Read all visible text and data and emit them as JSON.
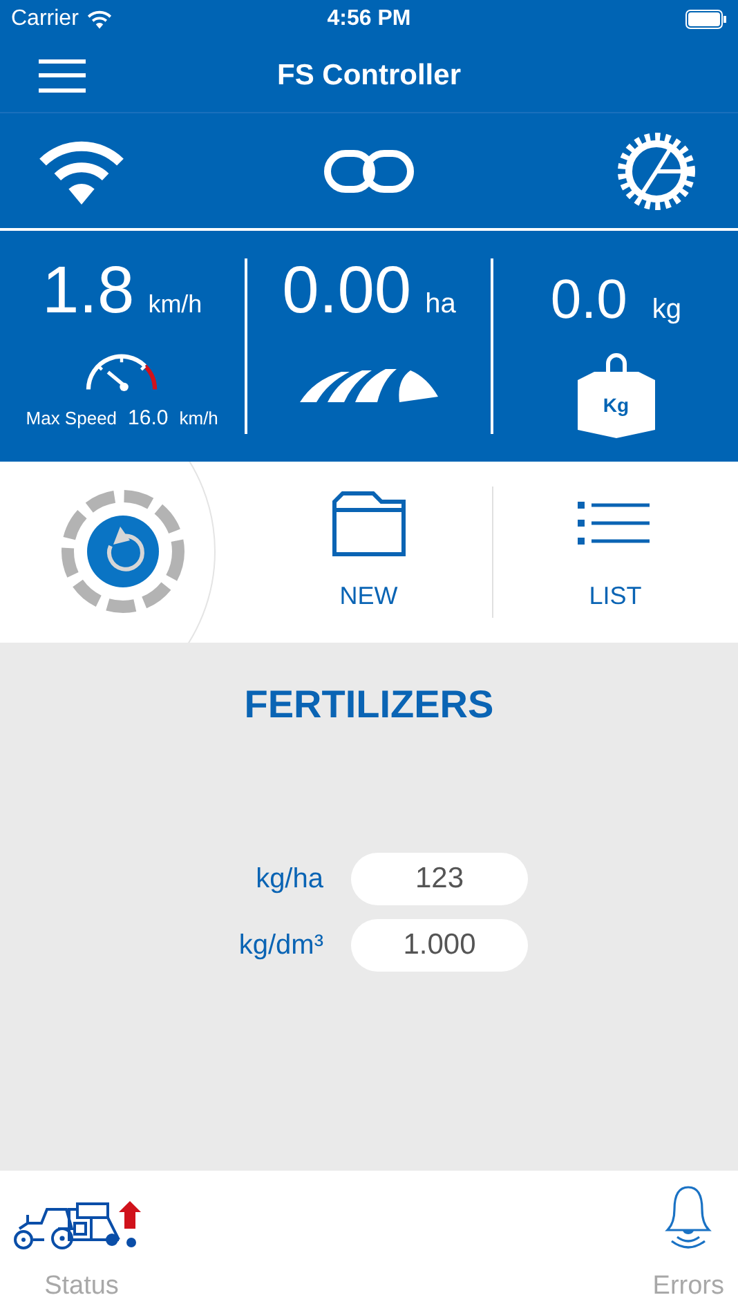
{
  "status_bar": {
    "carrier": "Carrier",
    "time": "4:56 PM"
  },
  "nav": {
    "title": "FS Controller"
  },
  "stats": {
    "speed": {
      "value": "1.8",
      "unit": "km/h",
      "max_label": "Max Speed",
      "max_value": "16.0",
      "max_unit": "km/h"
    },
    "area": {
      "value": "0.00",
      "unit": "ha"
    },
    "weight": {
      "value": "0.0",
      "unit": "kg",
      "icon_label": "Kg"
    }
  },
  "actions": [
    {
      "label": "NEW",
      "kind": "folder"
    },
    {
      "label": "LIST",
      "kind": "list"
    }
  ],
  "section": {
    "title": "FERTILIZERS",
    "fields": [
      {
        "label": "kg/ha",
        "value": "123"
      },
      {
        "label": "kg/dm³",
        "value": "1.000"
      }
    ]
  },
  "tabs": [
    {
      "label": "Status",
      "kind": "machine",
      "selected": false
    },
    {
      "label": "Errors",
      "kind": "bell",
      "selected": false
    }
  ]
}
